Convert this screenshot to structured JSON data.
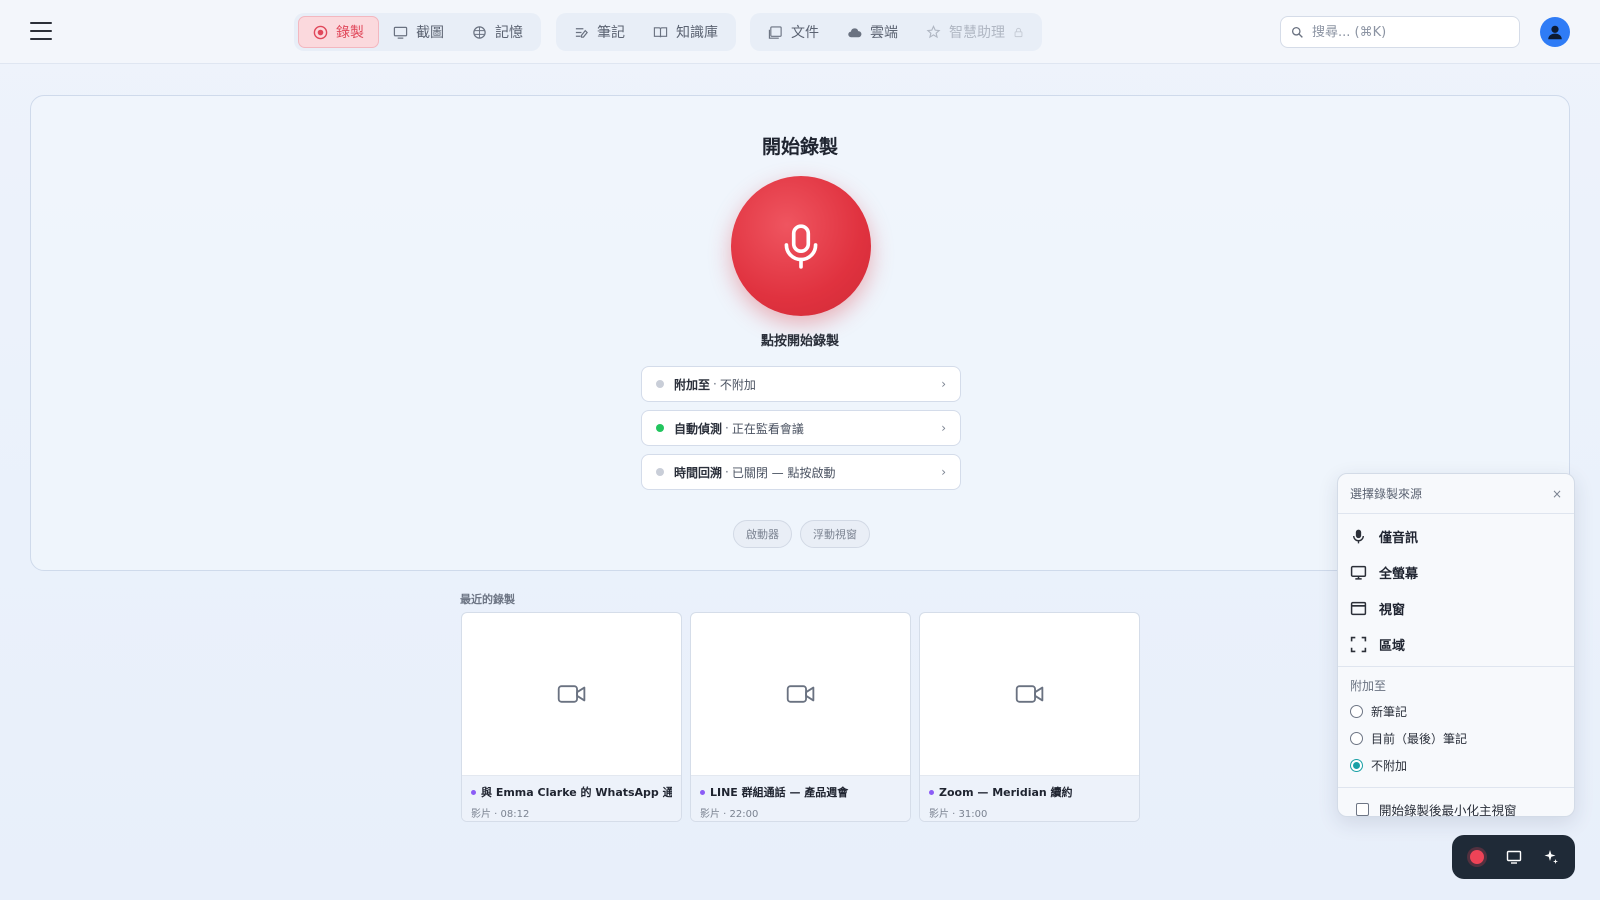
{
  "nav": {
    "group1": [
      {
        "label": "錄製",
        "icon": "record-icon",
        "active": true
      },
      {
        "label": "截圖",
        "icon": "screenshot-icon"
      },
      {
        "label": "記憶",
        "icon": "memory-icon"
      }
    ],
    "group2": [
      {
        "label": "筆記",
        "icon": "notes-icon"
      },
      {
        "label": "知識庫",
        "icon": "book-icon"
      }
    ],
    "group3": [
      {
        "label": "文件",
        "icon": "documents-icon"
      },
      {
        "label": "雲端",
        "icon": "cloud-icon"
      },
      {
        "label": "智慧助理",
        "icon": "assistant-icon",
        "disabled": true
      }
    ]
  },
  "search": {
    "placeholder": "搜尋... (⌘K)"
  },
  "main": {
    "title": "開始錄製",
    "mic_label": "點按開始錄製",
    "options": [
      {
        "key": "附加至",
        "value": "不附加",
        "status": "off"
      },
      {
        "key": "自動偵測",
        "value": "正在監看會議",
        "status": "on"
      },
      {
        "key": "時間回溯",
        "value": "已關閉 — 點按啟動",
        "status": "off"
      }
    ],
    "pills": [
      "啟動器",
      "浮動視窗"
    ]
  },
  "recent": {
    "title": "最近的錄製",
    "items": [
      {
        "name": "與 Emma Clarke 的 WhatsApp 通話",
        "meta": "影片 · 08:12"
      },
      {
        "name": "LINE 群組通話 — 產品週會",
        "meta": "影片 · 22:00"
      },
      {
        "name": "Zoom — Meridian 續約",
        "meta": "影片 · 31:00"
      }
    ]
  },
  "popup": {
    "title": "選擇錄製來源",
    "close": "×",
    "sources": [
      {
        "label": "僅音訊",
        "icon": "microphone-icon"
      },
      {
        "label": "全螢幕",
        "icon": "monitor-icon"
      },
      {
        "label": "視窗",
        "icon": "window-icon"
      },
      {
        "label": "區域",
        "icon": "region-icon"
      }
    ],
    "attach_title": "附加至",
    "attach_options": [
      {
        "label": "新筆記",
        "selected": false
      },
      {
        "label": "目前（最後）筆記",
        "selected": false
      },
      {
        "label": "不附加",
        "selected": true
      }
    ],
    "minimize_label": "開始錄製後最小化主視窗",
    "minimize_checked": false
  },
  "colors": {
    "accent": "#e0323f",
    "active_tab_bg": "#fbd9dd",
    "status_on": "#22c55e",
    "radio_selected": "#1aa0a6",
    "avatar": "#2f7cf6"
  }
}
